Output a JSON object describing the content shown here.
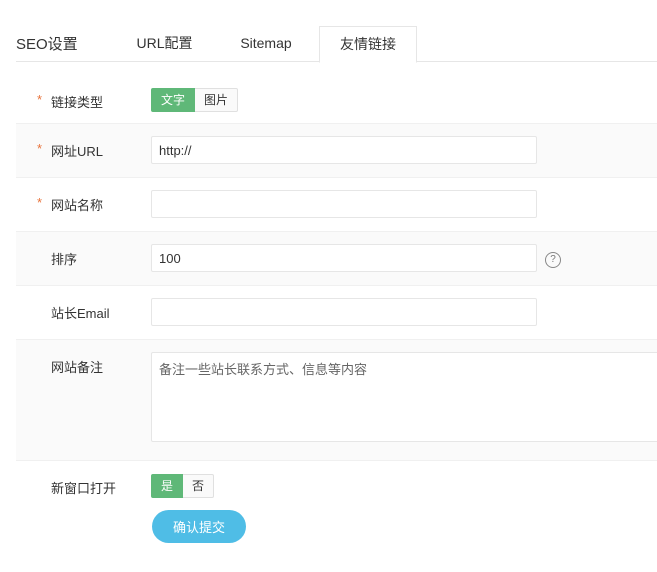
{
  "header": {
    "title": "SEO设置",
    "tabs": [
      {
        "label": "URL配置"
      },
      {
        "label": "Sitemap"
      },
      {
        "label": "友情链接"
      }
    ]
  },
  "form": {
    "link_type": {
      "label": "链接类型",
      "required_mark": "*",
      "options": [
        "文字",
        "图片"
      ],
      "selected": "文字"
    },
    "url": {
      "label": "网址URL",
      "required_mark": "*",
      "value": "http://"
    },
    "site_name": {
      "label": "网站名称",
      "required_mark": "*",
      "value": ""
    },
    "order": {
      "label": "排序",
      "value": "100",
      "help_glyph": "?"
    },
    "email": {
      "label": "站长Email",
      "value": ""
    },
    "remark": {
      "label": "网站备注",
      "placeholder": "备注一些站长联系方式、信息等内容"
    },
    "new_window": {
      "label": "新窗口打开",
      "options": [
        "是",
        "否"
      ],
      "selected": "是"
    },
    "submit_label": "确认提交"
  },
  "colors": {
    "accent_green": "#5fb878",
    "submit_blue": "#4fbde6",
    "required_orange": "#e8723a"
  }
}
